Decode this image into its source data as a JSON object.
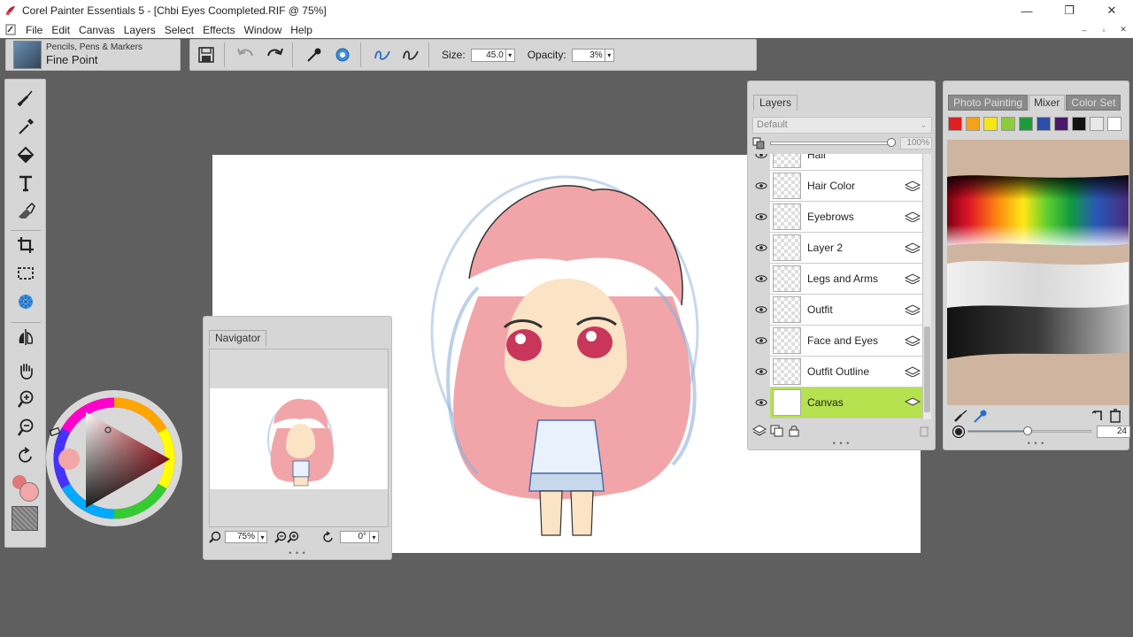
{
  "window": {
    "title": "Corel Painter Essentials 5 - [Chbi Eyes Coompleted.RIF @ 75%]",
    "controls": [
      "—",
      "❐",
      "✕"
    ],
    "mdi_controls": [
      "–",
      "▫",
      "✕"
    ]
  },
  "menu": [
    "File",
    "Edit",
    "Canvas",
    "Layers",
    "Select",
    "Effects",
    "Window",
    "Help"
  ],
  "brush": {
    "category": "Pencils, Pens & Markers",
    "variant": "Fine Point"
  },
  "propbar": {
    "size_label": "Size:",
    "size_value": "45.0",
    "opacity_label": "Opacity:",
    "opacity_value": "3%"
  },
  "navigator": {
    "tab": "Navigator",
    "zoom": "75%",
    "rotation": "0°"
  },
  "layers": {
    "tab": "Layers",
    "composite": "Default",
    "opacity": "100%",
    "items": [
      {
        "name": "Hair",
        "selected": false
      },
      {
        "name": "Hair Color",
        "selected": false
      },
      {
        "name": "Eyebrows",
        "selected": false
      },
      {
        "name": "Layer 2",
        "selected": false
      },
      {
        "name": "Legs and Arms",
        "selected": false
      },
      {
        "name": "Outfit",
        "selected": false
      },
      {
        "name": "Face and Eyes",
        "selected": false
      },
      {
        "name": "Outfit Outline",
        "selected": false
      },
      {
        "name": "Canvas",
        "selected": true
      }
    ]
  },
  "mixer": {
    "tabs": [
      "Photo Painting",
      "Mixer",
      "Color Set"
    ],
    "active_tab": "Mixer",
    "swatches": [
      "#e02020",
      "#f3a21a",
      "#f6e616",
      "#8ccc3c",
      "#1f9a3a",
      "#2c4ea8",
      "#4a1a6a",
      "#111111",
      "#e8e8e8",
      "#ffffff"
    ],
    "brush_size": "24"
  },
  "colors": {
    "accent_selected": "#b5e24e",
    "main_color": "#f4a6a6",
    "additional_color": "#e07a7a"
  },
  "grip": "• • •"
}
